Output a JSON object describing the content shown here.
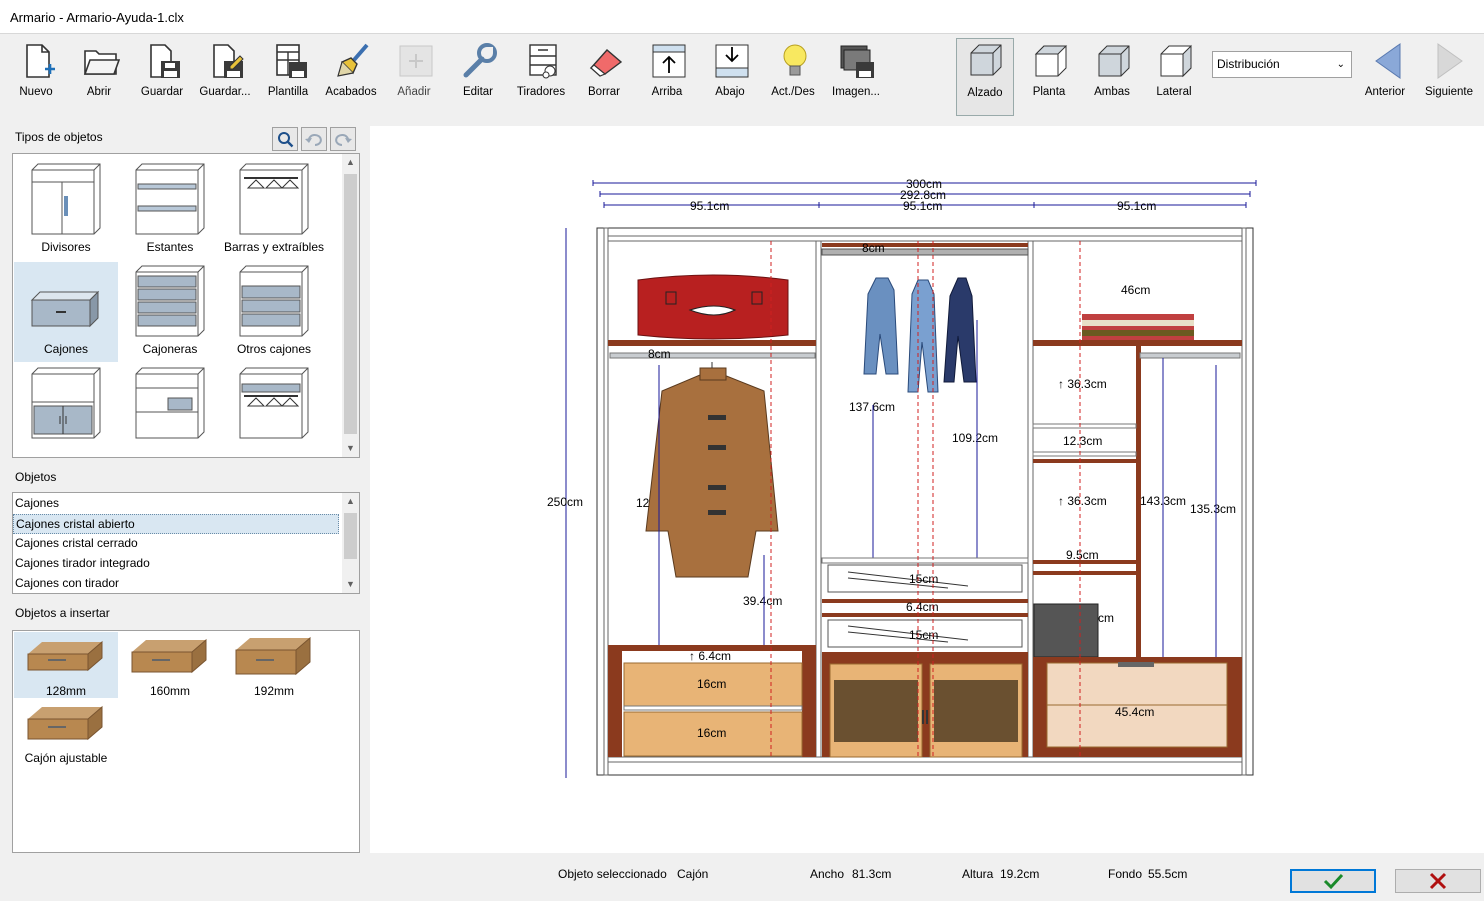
{
  "window": {
    "title": "Armario - Armario-Ayuda-1.clx"
  },
  "toolbar": {
    "nuevo": "Nuevo",
    "abrir": "Abrir",
    "guardar": "Guardar",
    "guardar_como": "Guardar...",
    "plantilla": "Plantilla",
    "acabados": "Acabados",
    "anadir": "Añadir",
    "editar": "Editar",
    "tiradores": "Tiradores",
    "borrar": "Borrar",
    "arriba": "Arriba",
    "abajo": "Abajo",
    "act_des": "Act./Des",
    "imagen": "Imagen...",
    "alzado": "Alzado",
    "planta": "Planta",
    "ambas": "Ambas",
    "lateral": "Lateral",
    "view_select": "Distribución",
    "anterior": "Anterior",
    "siguiente": "Siguiente"
  },
  "tipos": {
    "label": "Tipos de objetos",
    "items": [
      "Divisores",
      "Estantes",
      "Barras y extraíbles",
      "Cajones",
      "Cajoneras",
      "Otros cajones"
    ],
    "selected": "Cajones"
  },
  "objetos": {
    "label": "Objetos",
    "items": [
      "Cajones",
      "Cajones cristal abierto",
      "Cajones cristal cerrado",
      "Cajones tirador integrado",
      "Cajones con tirador"
    ],
    "selected": "Cajones cristal abierto"
  },
  "insertar": {
    "label": "Objetos a insertar",
    "items": [
      "128mm",
      "160mm",
      "192mm",
      "Cajón ajustable"
    ],
    "selected": "128mm"
  },
  "drawing": {
    "dims": {
      "total_w": "300cm",
      "inner_w": "292.8cm",
      "module_w": "95.1cm",
      "height": "250cm",
      "d8": "8cm",
      "d137": "137.6cm",
      "d109": "109.2cm",
      "d46": "46cm",
      "d36a": "↑ 36.3cm",
      "d12": "12.3cm",
      "d36b": "↑ 36.3cm",
      "d143": "143.3cm",
      "d135": "135.3cm",
      "d9": "9.5cm",
      "d39": "39.4cm",
      "d15a": "15cm",
      "d6a": "6.4cm",
      "d15b": "15cm",
      "d6b": "↑ 6.4cm",
      "d16a": "16cm",
      "d16b": "16cm",
      "d45": "45.4cm",
      "d12s": "12",
      "dcm": "cm"
    }
  },
  "status": {
    "selected_label": "Objeto seleccionado",
    "selected_value": "Cajón",
    "ancho_label": "Ancho",
    "ancho_value": "81.3cm",
    "altura_label": "Altura",
    "altura_value": "19.2cm",
    "fondo_label": "Fondo",
    "fondo_value": "55.5cm"
  },
  "colors": {
    "wood_dark": "#8b3a1e",
    "wood_light": "#e8b476",
    "dim_line": "#1a1a9a",
    "guide_red": "#d02020",
    "ok_accent": "#0078d7",
    "cancel_red": "#b01010"
  },
  "icons": [
    "new-file-icon",
    "folder-open-icon",
    "save-icon",
    "save-as-icon",
    "template-icon",
    "paintbrush-icon",
    "add-icon",
    "wrench-icon",
    "handles-icon",
    "eraser-icon",
    "arrow-up-icon",
    "arrow-down-icon",
    "lightbulb-icon",
    "image-icon",
    "cube-front-icon",
    "cube-top-icon",
    "cube-both-icon",
    "cube-side-icon",
    "triangle-left-icon",
    "triangle-right-icon",
    "search-icon",
    "undo-icon",
    "redo-icon",
    "checkmark-icon",
    "x-icon"
  ]
}
